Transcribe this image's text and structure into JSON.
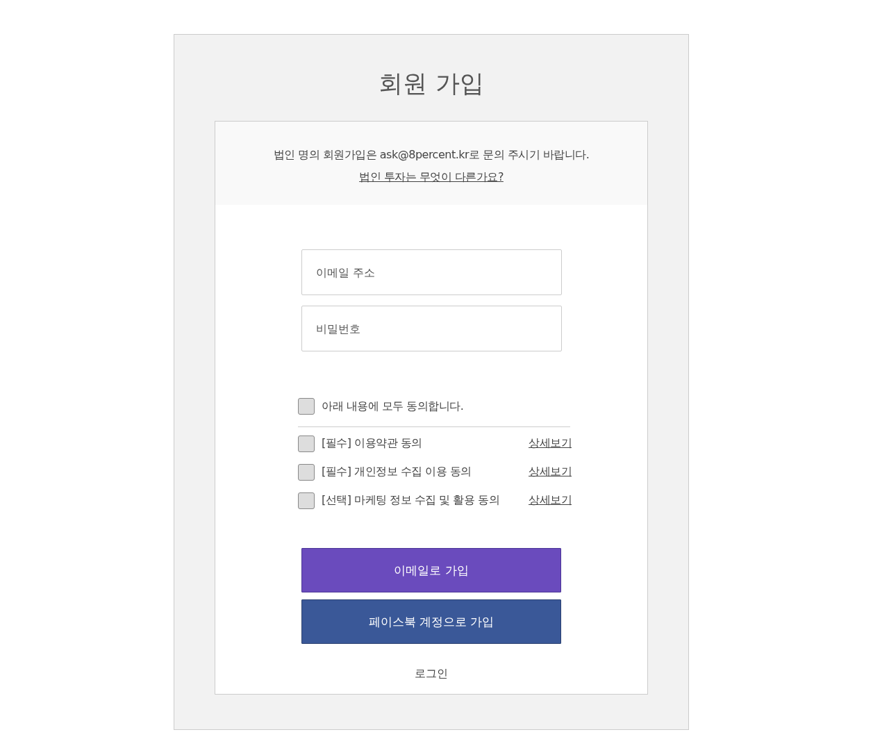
{
  "title": "회원 가입",
  "notice": {
    "text": "법인 명의 회원가입은 ask@8percent.kr로 문의 주시기 바랍니다.",
    "link": "법인 투자는 무엇이 다른가요?"
  },
  "fields": [
    {
      "placeholder": "이메일 주소"
    },
    {
      "placeholder": "비밀번호"
    }
  ],
  "agree_all": {
    "label": "아래 내용에 모두 동의합니다.",
    "checked": false
  },
  "agreements": [
    {
      "label": "[필수] 이용약관 동의",
      "checked": false,
      "link": "상세보기"
    },
    {
      "label": "[필수] 개인정보 수집 이용 동의",
      "checked": false,
      "link": "상세보기"
    },
    {
      "label": "[선택] 마케팅 정보 수집 및 활용 동의",
      "checked": false,
      "link": "상세보기"
    }
  ],
  "buttons": [
    {
      "label": "이메일로 가입",
      "kind": "email"
    },
    {
      "label": "페이스북 계정으로 가입",
      "kind": "facebook"
    }
  ],
  "login_link": "로그인"
}
